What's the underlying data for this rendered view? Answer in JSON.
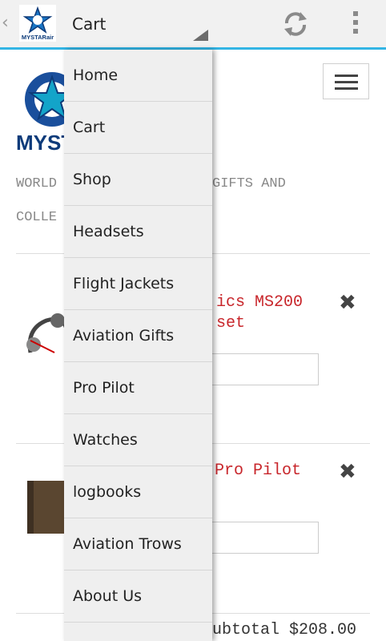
{
  "action_bar": {
    "logo_text": "MYSTARair",
    "nav_title": "Cart",
    "icons": [
      "chevron-left-icon",
      "refresh-icon",
      "overflow-menu-icon"
    ],
    "accent_color": "#33b5e5"
  },
  "drawer": {
    "items": [
      {
        "label": "Home"
      },
      {
        "label": "Cart"
      },
      {
        "label": "Shop"
      },
      {
        "label": "Headsets"
      },
      {
        "label": "Flight Jackets"
      },
      {
        "label": "Aviation Gifts"
      },
      {
        "label": "Pro Pilot"
      },
      {
        "label": "Watches"
      },
      {
        "label": "logbooks"
      },
      {
        "label": "Aviation Trows"
      },
      {
        "label": "About Us"
      }
    ]
  },
  "page": {
    "logo_text": "MYST",
    "tagline_line1": "WORLD",
    "tagline_line1_end": "GIFTS AND",
    "tagline_line2": "COLLE",
    "cart_items": [
      {
        "name_line1": "ics MS200",
        "name_line2": "set",
        "remove_icon": "close-icon"
      },
      {
        "name_line1": "Pro Pilot",
        "remove_icon": "close-icon"
      }
    ],
    "subtotal_text": "ubtotal $208.00"
  }
}
